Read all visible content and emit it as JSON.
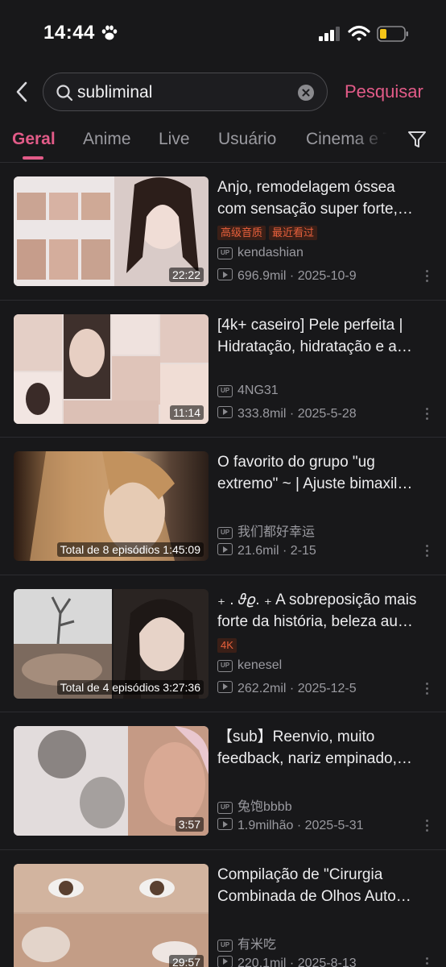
{
  "status_bar": {
    "time": "14:44",
    "icons": [
      "paw-icon",
      "signal-icon",
      "wifi-icon",
      "battery-icon"
    ]
  },
  "search": {
    "query": "subliminal",
    "button_label": "Pesquisar"
  },
  "tabs": [
    {
      "label": "Geral",
      "active": true
    },
    {
      "label": "Anime",
      "active": false
    },
    {
      "label": "Live",
      "active": false
    },
    {
      "label": "Usuário",
      "active": false
    },
    {
      "label": "Cinema e T",
      "active": false
    }
  ],
  "colors": {
    "accent": "#e25b88",
    "background": "#18181a",
    "tag_text": "#e8603c"
  },
  "videos": [
    {
      "title_line1": "Anjo, remodelagem óssea",
      "title_line2": "com sensação super forte,…",
      "tags": [
        "高级音质",
        "最近看过"
      ],
      "uploader": "kendashian",
      "views": "696.9mil",
      "date": "2025-10-9",
      "duration": "22:22"
    },
    {
      "title_line1": "[4k+ caseiro] Pele perfeita |",
      "title_line2": "Hidratação, hidratação e a…",
      "tags": [],
      "uploader": "4NG31",
      "views": "333.8mil",
      "date": "2025-5-28",
      "duration": "11:14"
    },
    {
      "title_line1": "O favorito do grupo \"ug",
      "title_line2": "extremo\" ~ | Ajuste bimaxil…",
      "tags": [],
      "uploader": "我们都好幸运",
      "views": "21.6mil",
      "date": "2-15",
      "duration": "Total de 8 episódios 1:45:09"
    },
    {
      "title_line1": "₊ . 𝜗𝜚. ₊ A sobreposição mais",
      "title_line2": "forte da história, beleza au…",
      "tags": [
        "4K"
      ],
      "uploader": "kenesel",
      "views": "262.2mil",
      "date": "2025-12-5",
      "duration": "Total de 4 episódios 3:27:36"
    },
    {
      "title_line1": "【sub】Reenvio, muito",
      "title_line2": "feedback, nariz empinado,…",
      "tags": [],
      "uploader": "兔饱bbbb",
      "views": "1.9milhão",
      "date": "2025-5-31",
      "duration": "3:57"
    },
    {
      "title_line1": "Compilação de \"Cirurgia",
      "title_line2": "Combinada de Olhos Auto…",
      "tags": [],
      "uploader": "有米吃",
      "views": "220.1mil",
      "date": "2025-8-13",
      "duration": "29:57"
    }
  ]
}
